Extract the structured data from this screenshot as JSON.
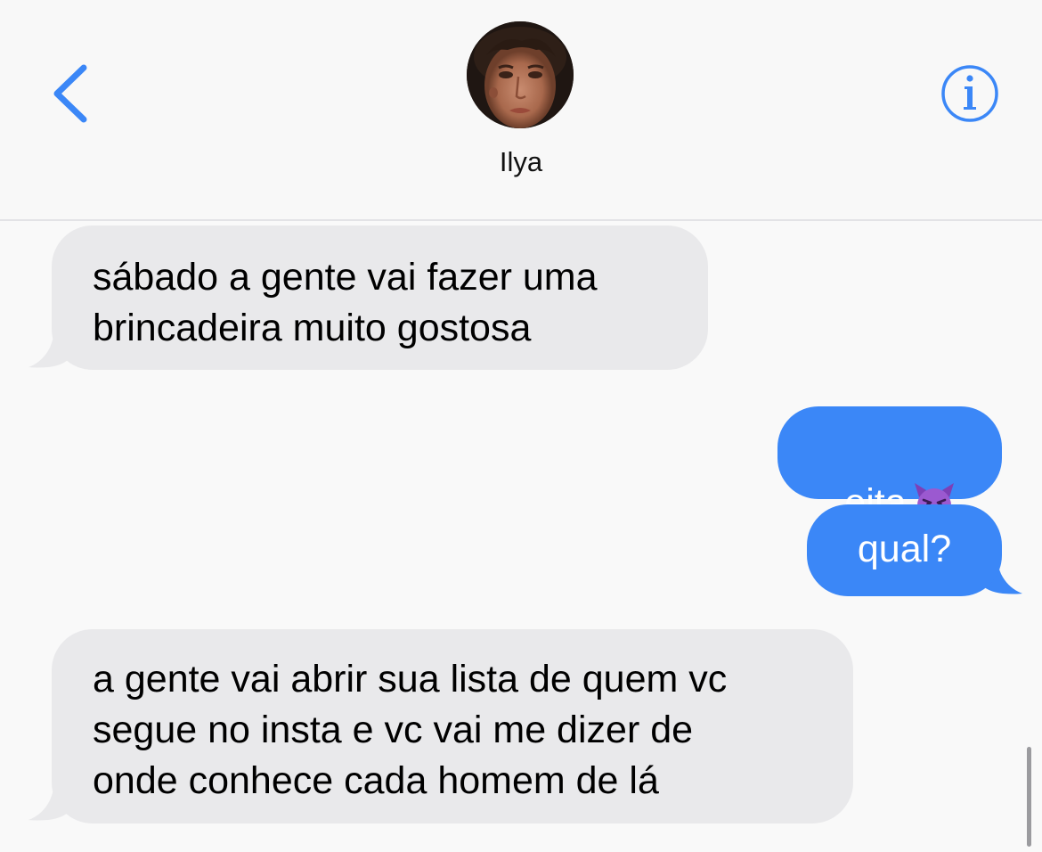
{
  "header": {
    "contact_name": "Ilya",
    "back_icon": "chevron-left-icon",
    "info_icon": "info-icon",
    "accent_color": "#3b87f7"
  },
  "messages": [
    {
      "direction": "incoming",
      "text": "sábado a gente vai fazer uma\nbrincadeira muito gostosa"
    },
    {
      "direction": "outgoing",
      "text": "eita",
      "emoji": "smiling-devil-emoji"
    },
    {
      "direction": "outgoing",
      "text": "qual?"
    },
    {
      "direction": "incoming",
      "text": "a gente vai abrir sua lista de quem vc\nsegue no insta e vc vai me dizer de\nonde conhece cada homem de lá"
    }
  ],
  "colors": {
    "incoming_bubble": "#e9e9eb",
    "outgoing_bubble": "#3b87f7",
    "background": "#f9f9f9"
  }
}
